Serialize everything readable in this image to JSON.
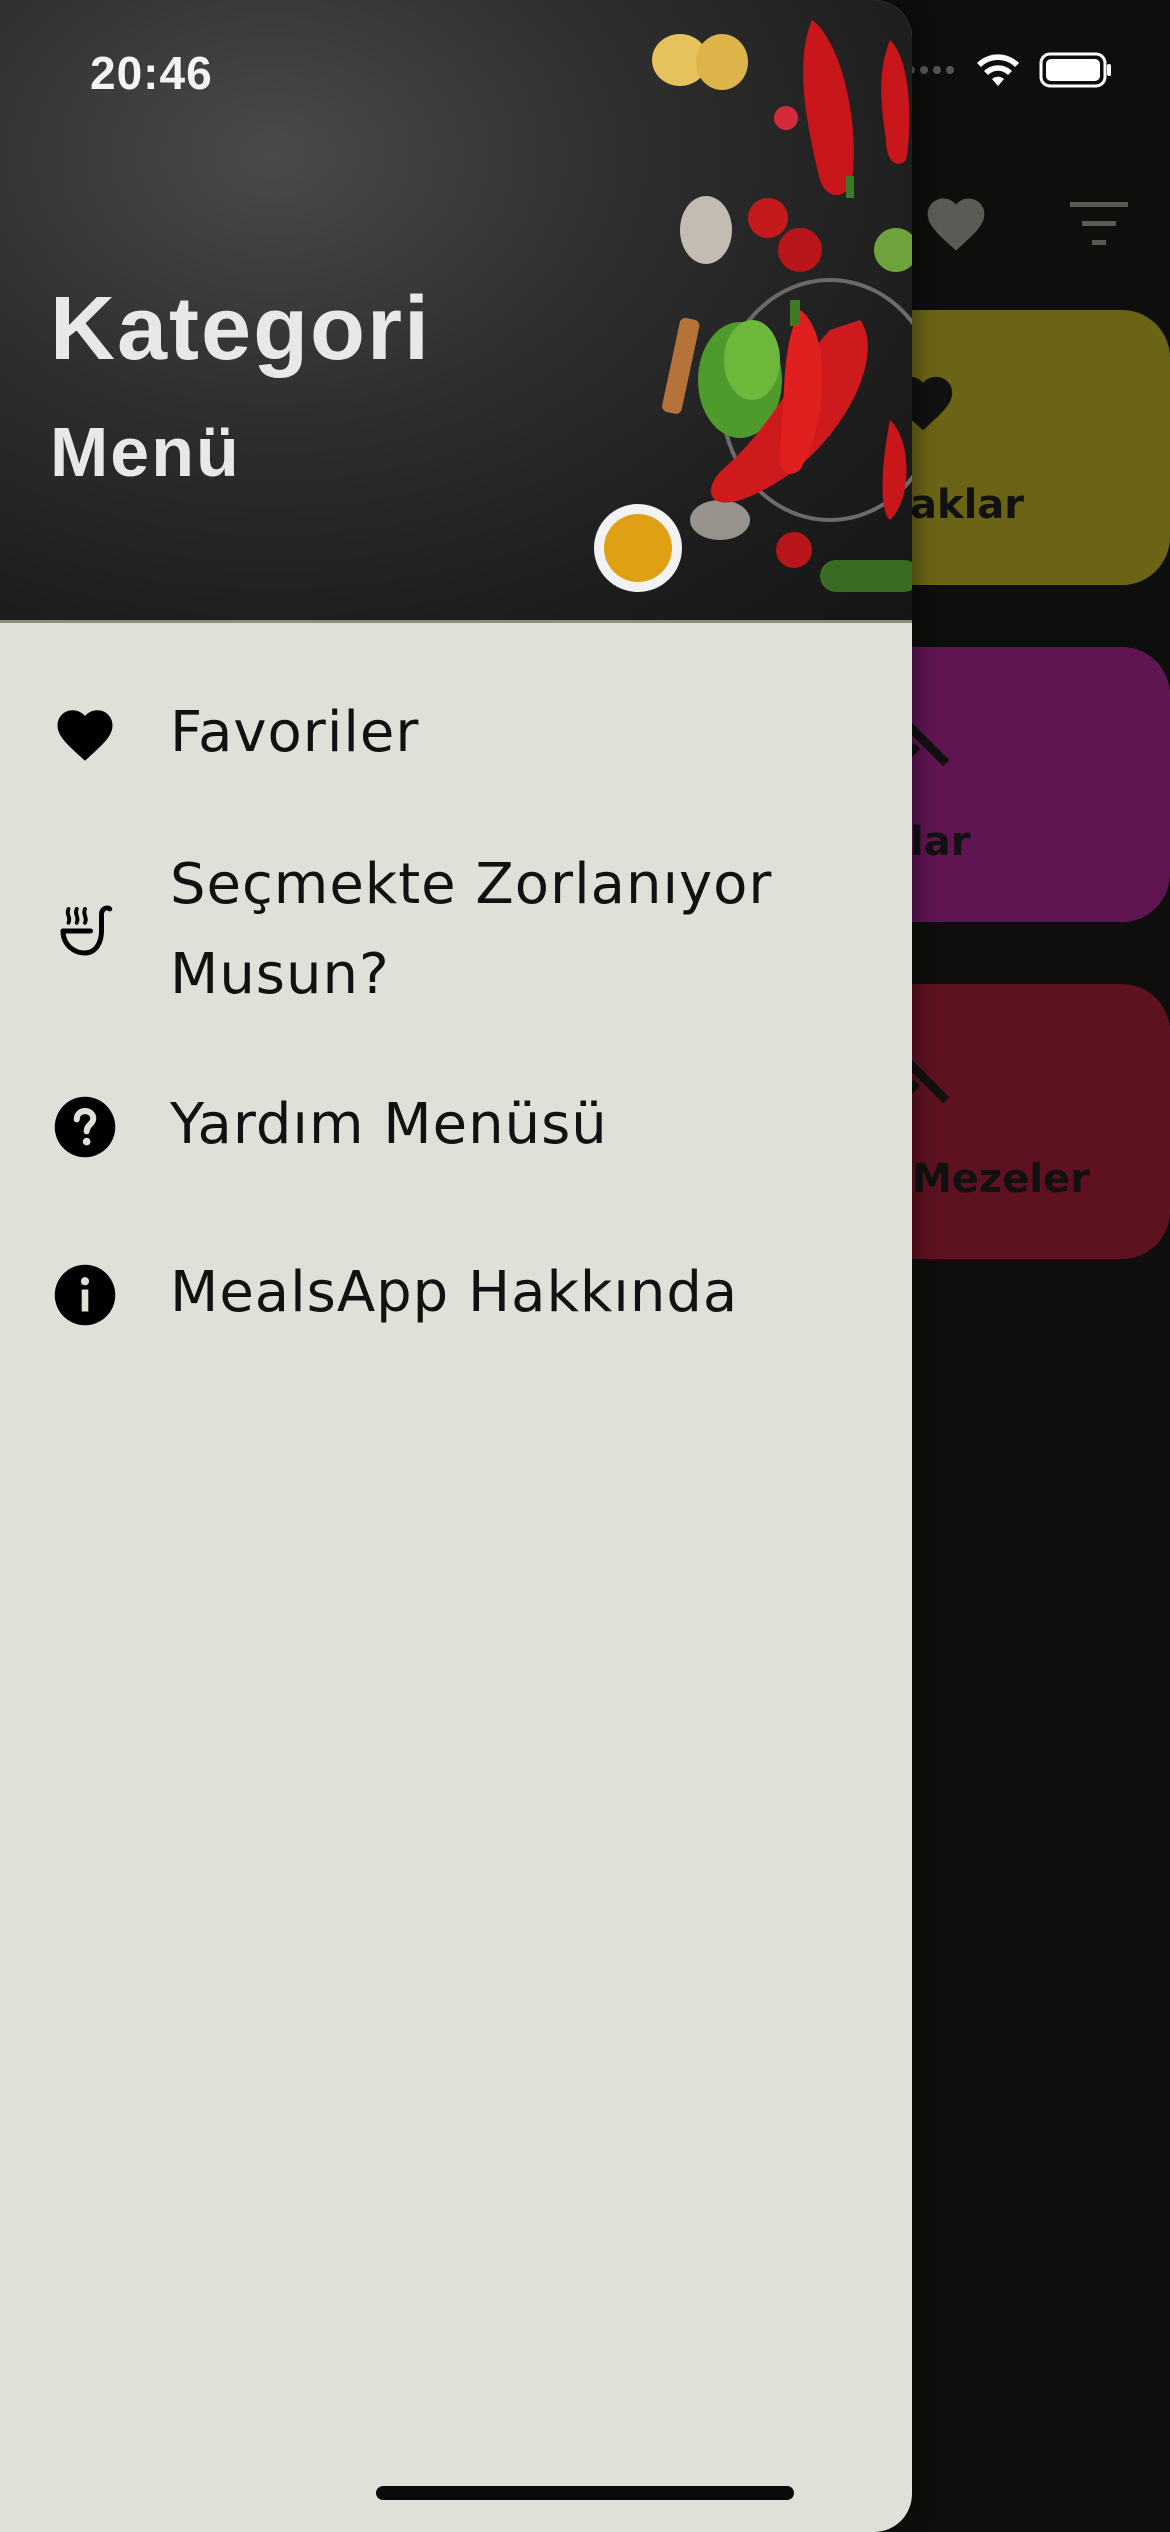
{
  "status_bar": {
    "time": "20:46"
  },
  "drawer": {
    "header": {
      "title": "Kategori",
      "subtitle": "Menü"
    },
    "items": [
      {
        "label": "Favoriler",
        "icon": "heart-icon"
      },
      {
        "label": "Seçmekte Zorlanıyor Musun?",
        "icon": "soup-ladle-icon"
      },
      {
        "label": "Yardım Menüsü",
        "icon": "help-circle-icon"
      },
      {
        "label": "MealsApp Hakkında",
        "icon": "info-circle-icon"
      }
    ]
  },
  "background_app": {
    "cards": [
      {
        "label": "aklar",
        "color": "#6b6416"
      },
      {
        "label": "lar",
        "color": "#5e1552"
      },
      {
        "label": "Mezeler",
        "color": "#5e1220"
      }
    ]
  },
  "colors": {
    "drawer_bg": "#e0e0d8",
    "app_bg": "#0e0e0d"
  }
}
